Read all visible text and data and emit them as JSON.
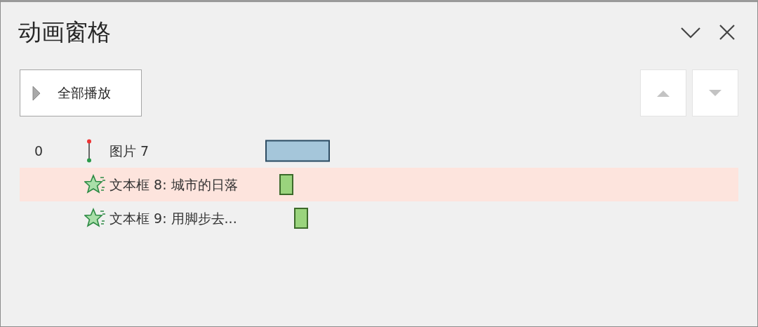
{
  "pane": {
    "title": "动画窗格"
  },
  "play_all_button": {
    "label": "全部播放"
  },
  "animations": [
    {
      "number": "0",
      "kind": "motion",
      "label": "图片 7",
      "selected": false,
      "color": "#a5c6da"
    },
    {
      "kind": "entrance",
      "label": "文本框 8: 城市的日落",
      "selected": true,
      "color": "#9ad47d"
    },
    {
      "kind": "entrance",
      "label": "文本框 9: 用脚步去...",
      "selected": false,
      "color": "#9ad47d"
    }
  ]
}
